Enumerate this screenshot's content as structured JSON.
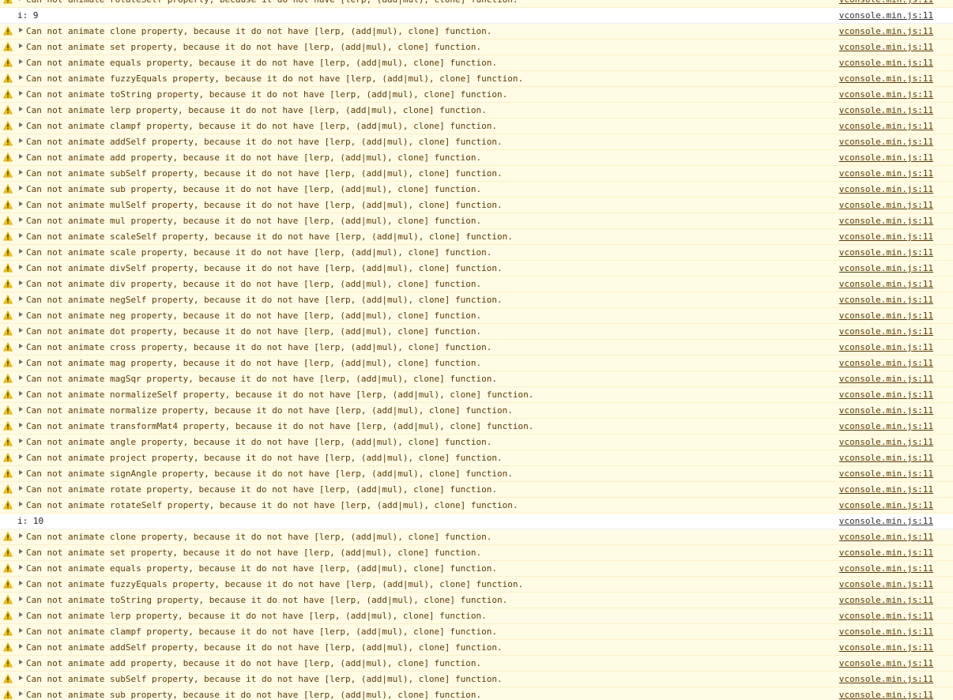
{
  "console": {
    "source_label": "vconsole.min.js:11",
    "colors": {
      "warn_background": "#fffbe5",
      "warn_text": "#5c3b00",
      "warn_icon": "#f2c200",
      "log_background": "#ffffff"
    },
    "rows": [
      {
        "type": "warn",
        "text": "Can not animate rotateSelf property, because it do not have [lerp, (add|mul), clone] function."
      },
      {
        "type": "log",
        "text": "i: 9"
      },
      {
        "type": "warn",
        "text": "Can not animate clone property, because it do not have [lerp, (add|mul), clone] function."
      },
      {
        "type": "warn",
        "text": "Can not animate set property, because it do not have [lerp, (add|mul), clone] function."
      },
      {
        "type": "warn",
        "text": "Can not animate equals property, because it do not have [lerp, (add|mul), clone] function."
      },
      {
        "type": "warn",
        "text": "Can not animate fuzzyEquals property, because it do not have [lerp, (add|mul), clone] function."
      },
      {
        "type": "warn",
        "text": "Can not animate toString property, because it do not have [lerp, (add|mul), clone] function."
      },
      {
        "type": "warn",
        "text": "Can not animate lerp property, because it do not have [lerp, (add|mul), clone] function."
      },
      {
        "type": "warn",
        "text": "Can not animate clampf property, because it do not have [lerp, (add|mul), clone] function."
      },
      {
        "type": "warn",
        "text": "Can not animate addSelf property, because it do not have [lerp, (add|mul), clone] function."
      },
      {
        "type": "warn",
        "text": "Can not animate add property, because it do not have [lerp, (add|mul), clone] function."
      },
      {
        "type": "warn",
        "text": "Can not animate subSelf property, because it do not have [lerp, (add|mul), clone] function."
      },
      {
        "type": "warn",
        "text": "Can not animate sub property, because it do not have [lerp, (add|mul), clone] function."
      },
      {
        "type": "warn",
        "text": "Can not animate mulSelf property, because it do not have [lerp, (add|mul), clone] function."
      },
      {
        "type": "warn",
        "text": "Can not animate mul property, because it do not have [lerp, (add|mul), clone] function."
      },
      {
        "type": "warn",
        "text": "Can not animate scaleSelf property, because it do not have [lerp, (add|mul), clone] function."
      },
      {
        "type": "warn",
        "text": "Can not animate scale property, because it do not have [lerp, (add|mul), clone] function."
      },
      {
        "type": "warn",
        "text": "Can not animate divSelf property, because it do not have [lerp, (add|mul), clone] function."
      },
      {
        "type": "warn",
        "text": "Can not animate div property, because it do not have [lerp, (add|mul), clone] function."
      },
      {
        "type": "warn",
        "text": "Can not animate negSelf property, because it do not have [lerp, (add|mul), clone] function."
      },
      {
        "type": "warn",
        "text": "Can not animate neg property, because it do not have [lerp, (add|mul), clone] function."
      },
      {
        "type": "warn",
        "text": "Can not animate dot property, because it do not have [lerp, (add|mul), clone] function."
      },
      {
        "type": "warn",
        "text": "Can not animate cross property, because it do not have [lerp, (add|mul), clone] function."
      },
      {
        "type": "warn",
        "text": "Can not animate mag property, because it do not have [lerp, (add|mul), clone] function."
      },
      {
        "type": "warn",
        "text": "Can not animate magSqr property, because it do not have [lerp, (add|mul), clone] function."
      },
      {
        "type": "warn",
        "text": "Can not animate normalizeSelf property, because it do not have [lerp, (add|mul), clone] function."
      },
      {
        "type": "warn",
        "text": "Can not animate normalize property, because it do not have [lerp, (add|mul), clone] function."
      },
      {
        "type": "warn",
        "text": "Can not animate transformMat4 property, because it do not have [lerp, (add|mul), clone] function."
      },
      {
        "type": "warn",
        "text": "Can not animate angle property, because it do not have [lerp, (add|mul), clone] function."
      },
      {
        "type": "warn",
        "text": "Can not animate project property, because it do not have [lerp, (add|mul), clone] function."
      },
      {
        "type": "warn",
        "text": "Can not animate signAngle property, because it do not have [lerp, (add|mul), clone] function."
      },
      {
        "type": "warn",
        "text": "Can not animate rotate property, because it do not have [lerp, (add|mul), clone] function."
      },
      {
        "type": "warn",
        "text": "Can not animate rotateSelf property, because it do not have [lerp, (add|mul), clone] function."
      },
      {
        "type": "log",
        "text": "i: 10"
      },
      {
        "type": "warn",
        "text": "Can not animate clone property, because it do not have [lerp, (add|mul), clone] function."
      },
      {
        "type": "warn",
        "text": "Can not animate set property, because it do not have [lerp, (add|mul), clone] function."
      },
      {
        "type": "warn",
        "text": "Can not animate equals property, because it do not have [lerp, (add|mul), clone] function."
      },
      {
        "type": "warn",
        "text": "Can not animate fuzzyEquals property, because it do not have [lerp, (add|mul), clone] function."
      },
      {
        "type": "warn",
        "text": "Can not animate toString property, because it do not have [lerp, (add|mul), clone] function."
      },
      {
        "type": "warn",
        "text": "Can not animate lerp property, because it do not have [lerp, (add|mul), clone] function."
      },
      {
        "type": "warn",
        "text": "Can not animate clampf property, because it do not have [lerp, (add|mul), clone] function."
      },
      {
        "type": "warn",
        "text": "Can not animate addSelf property, because it do not have [lerp, (add|mul), clone] function."
      },
      {
        "type": "warn",
        "text": "Can not animate add property, because it do not have [lerp, (add|mul), clone] function."
      },
      {
        "type": "warn",
        "text": "Can not animate subSelf property, because it do not have [lerp, (add|mul), clone] function."
      },
      {
        "type": "warn",
        "text": "Can not animate sub property, because it do not have [lerp, (add|mul), clone] function."
      }
    ]
  }
}
